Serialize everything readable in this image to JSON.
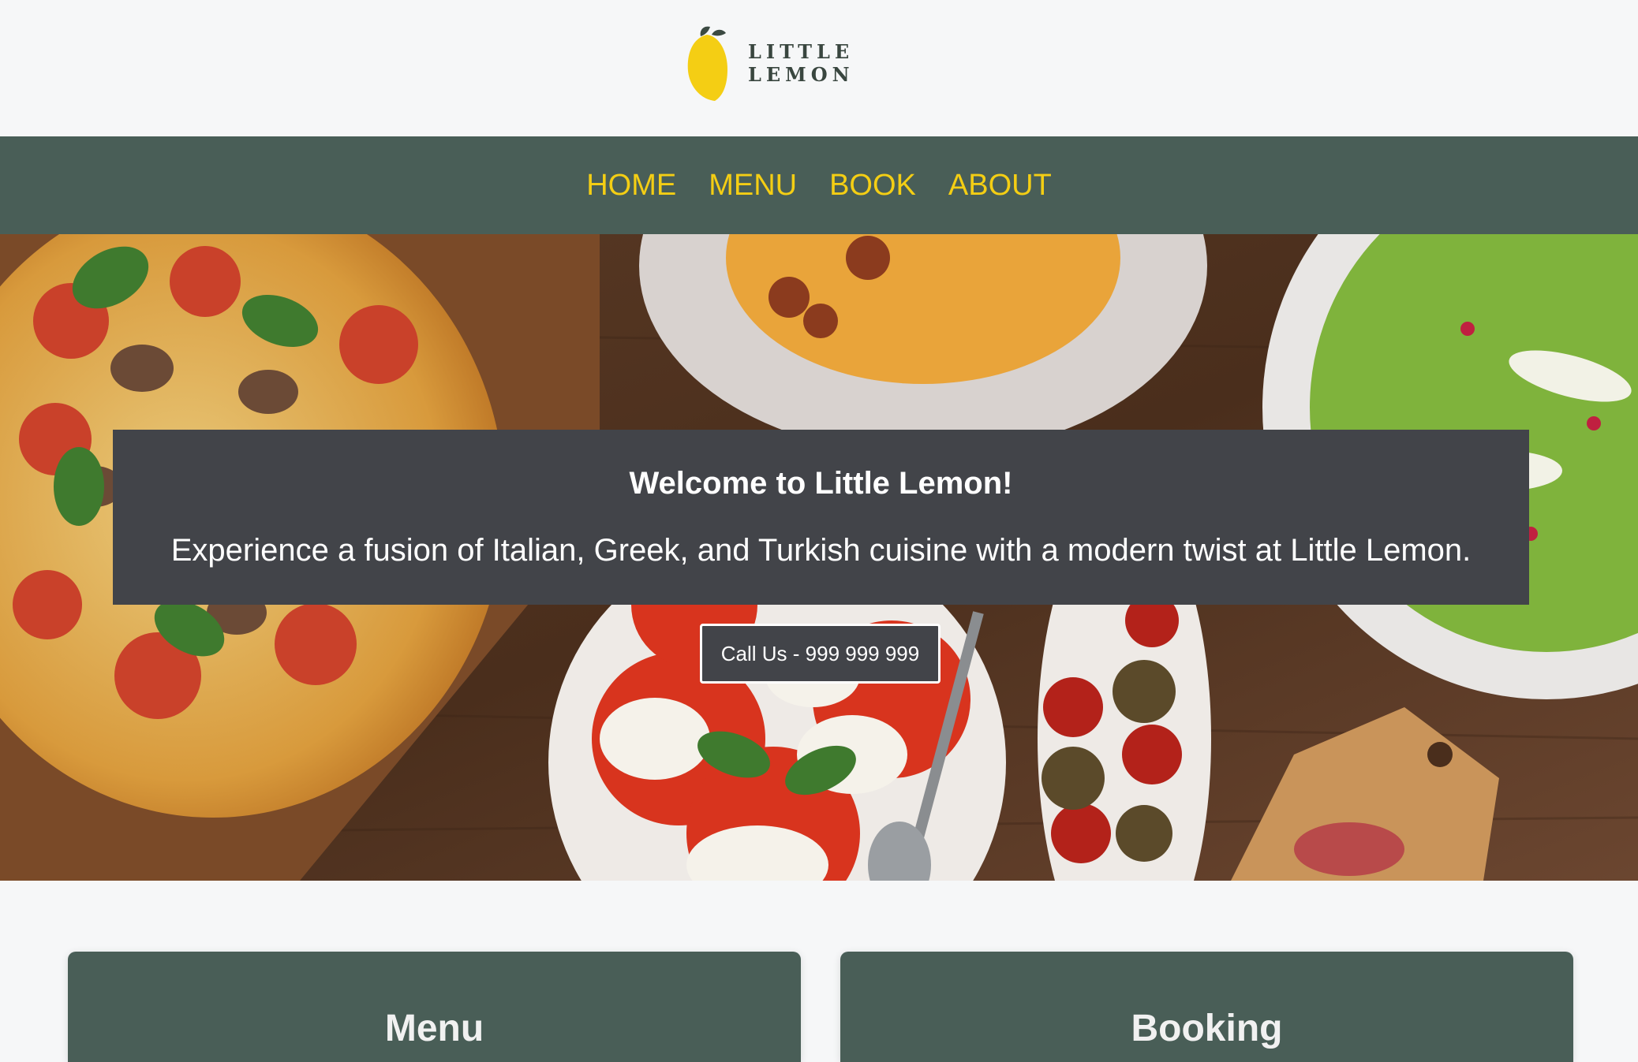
{
  "header": {
    "logo_text": "LITTLE LEMON",
    "logo_icon": "lemon-icon"
  },
  "nav": {
    "items": [
      {
        "label": "HOME"
      },
      {
        "label": "MENU"
      },
      {
        "label": "BOOK"
      },
      {
        "label": "ABOUT"
      }
    ]
  },
  "hero": {
    "title": "Welcome to Little Lemon!",
    "subtitle": "Experience a fusion of Italian, Greek, and Turkish cuisine with a modern twist at Little Lemon.",
    "call_button": "Call Us - 999 999 999",
    "image": "food-spread-photo"
  },
  "cards": [
    {
      "title": "Menu"
    },
    {
      "title": "Booking"
    }
  ],
  "colors": {
    "brand_green": "#495e57",
    "brand_yellow": "#f4ce14",
    "overlay_gray": "#424449",
    "page_bg": "#f6f7f8"
  }
}
